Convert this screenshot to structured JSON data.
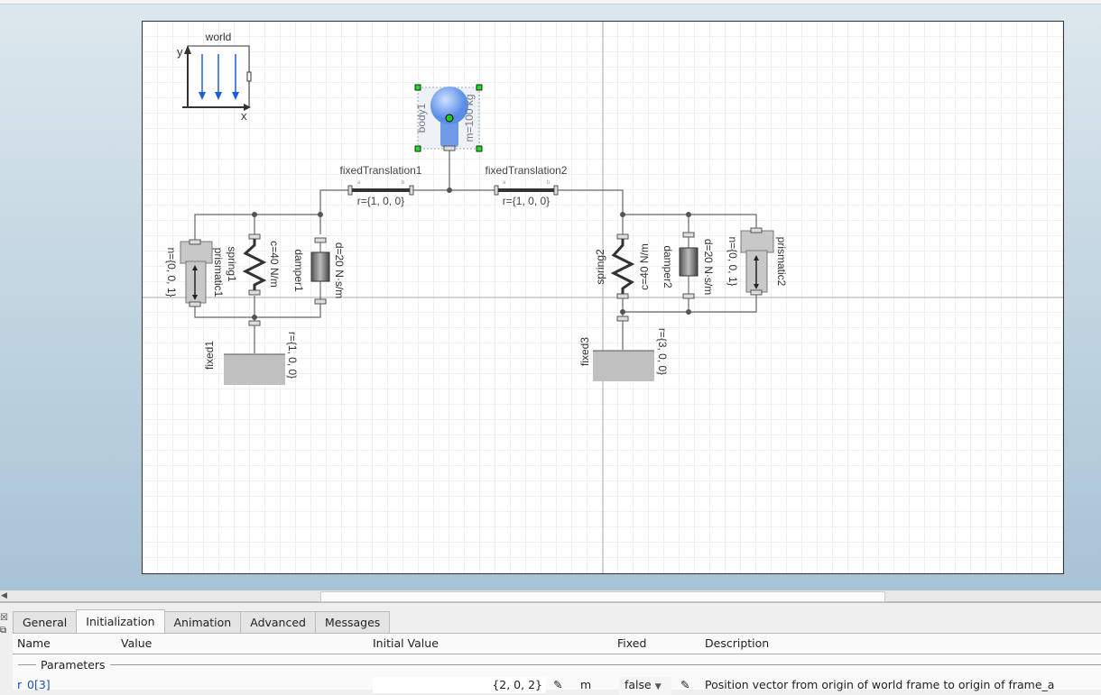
{
  "diagram": {
    "world": {
      "label": "world",
      "axis_x": "x",
      "axis_y": "y"
    },
    "body": {
      "name": "body1",
      "param": "m=100 kg"
    },
    "fixedTranslation1": {
      "name": "fixedTranslation1",
      "param": "r={1, 0, 0}"
    },
    "fixedTranslation2": {
      "name": "fixedTranslation2",
      "param": "r={1, 0, 0}"
    },
    "spring1": {
      "name": "spring1",
      "param": "c=40 N/m"
    },
    "damper1": {
      "name": "damper1",
      "param": "d=20 N·s/m"
    },
    "prismatic1": {
      "name": "prismatic1",
      "param": "n={0, 0, 1}"
    },
    "fixed1": {
      "name": "fixed1",
      "param": "r={1, 0, 0}"
    },
    "spring2": {
      "name": "spring2",
      "param": "c=40 N/m"
    },
    "damper2": {
      "name": "damper2",
      "param": "d=20 N·s/m"
    },
    "prismatic2": {
      "name": "prismatic2",
      "param": "n={0, 0, 1}"
    },
    "fixed3": {
      "name": "fixed3",
      "param": "r={3, 0, 0}"
    },
    "port_a": "a",
    "port_b": "b"
  },
  "tabs": [
    "General",
    "Initialization",
    "Animation",
    "Advanced",
    "Messages"
  ],
  "active_tab": "Initialization",
  "columns": {
    "name": "Name",
    "value": "Value",
    "initial": "Initial Value",
    "fixed": "Fixed",
    "description": "Description"
  },
  "group": "Parameters",
  "rows": [
    {
      "name_prefix": "r",
      "name_rest": "0[3]",
      "initial": "{2, 0, 2}",
      "unit": "m",
      "fixed": "false",
      "description": "Position vector from origin of world frame to origin of frame_a"
    }
  ]
}
